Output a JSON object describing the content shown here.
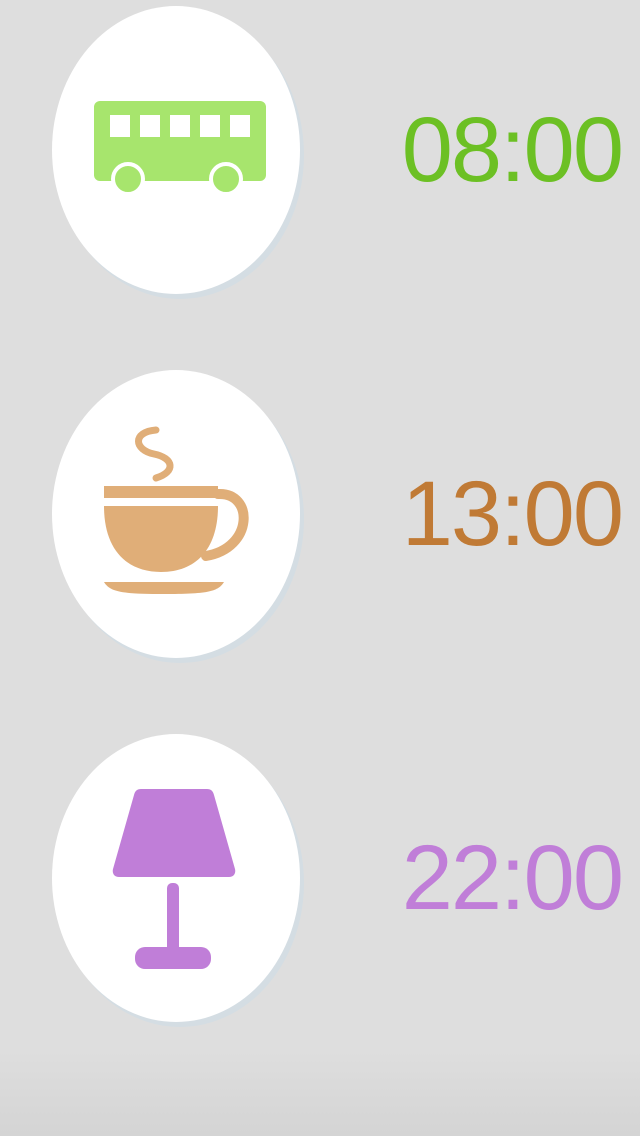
{
  "alarms": [
    {
      "time": "08:00",
      "icon": "bus-icon",
      "color": "#6cc024",
      "icon_color": "#a7e56d"
    },
    {
      "time": "13:00",
      "icon": "coffee-cup-icon",
      "color": "#c07a35",
      "icon_color": "#e0ae78"
    },
    {
      "time": "22:00",
      "icon": "lamp-icon",
      "color": "#c07ed8",
      "icon_color": "#c07ed8"
    }
  ]
}
